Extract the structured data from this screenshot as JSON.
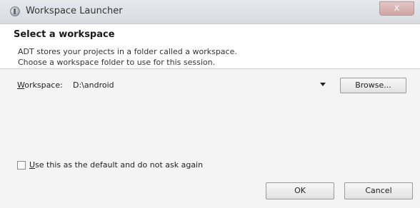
{
  "window": {
    "title": "Workspace Launcher",
    "close_glyph": "x"
  },
  "header": {
    "title": "Select a workspace",
    "line1": "ADT stores your projects in a folder called a workspace.",
    "line2": "Choose a workspace folder to use for this session."
  },
  "workspace": {
    "label_mnemonic": "W",
    "label_rest": "orkspace:",
    "value": "D:\\android",
    "browse_label": "Browse..."
  },
  "default_checkbox": {
    "checked": false,
    "label_mnemonic": "U",
    "label_rest": "se this as the default and do not ask again"
  },
  "buttons": {
    "ok": "OK",
    "cancel": "Cancel"
  },
  "icons": {
    "app": "eclipse-icon",
    "close": "close-icon",
    "dropdown": "chevron-down-icon"
  }
}
